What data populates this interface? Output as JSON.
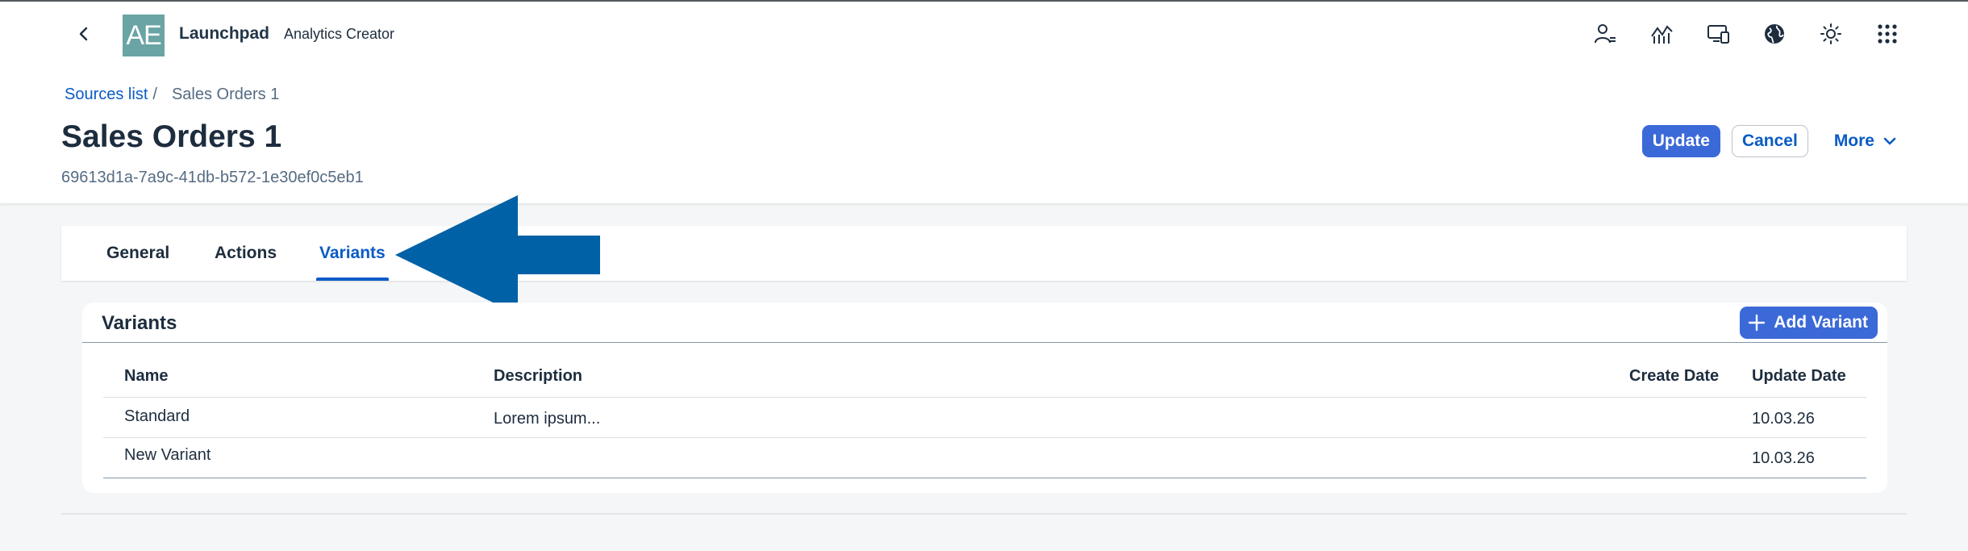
{
  "shell": {
    "logo_text": "AE",
    "brand": "Launchpad",
    "app_name": "Analytics Creator",
    "icons": [
      "user-settings-icon",
      "analytics-icon",
      "device-icon",
      "globe-icon",
      "theme-icon",
      "app-grid-icon"
    ]
  },
  "header": {
    "breadcrumb_link": "Sources list",
    "breadcrumb_sep": "/",
    "breadcrumb_current": "Sales Orders 1",
    "title": "Sales Orders 1",
    "subtitle": "69613d1a-7a9c-41db-b572-1e30ef0c5eb1",
    "update_label": "Update",
    "cancel_label": "Cancel",
    "more_label": "More"
  },
  "tabs": [
    {
      "label": "General"
    },
    {
      "label": "Actions"
    },
    {
      "label": "Variants",
      "active": true
    }
  ],
  "variants": {
    "title": "Variants",
    "add_label": "Add Variant",
    "columns": [
      "Name",
      "Description",
      "Create Date",
      "Update Date"
    ],
    "rows": [
      {
        "name": "Standard",
        "description": "Lorem ipsum...",
        "create_date": "",
        "update_date": "10.03.26"
      },
      {
        "name": "New Variant",
        "description": "",
        "create_date": "",
        "update_date": "10.03.26"
      }
    ]
  },
  "colors": {
    "accent": "#0a5bc6",
    "button": "#3b69d8",
    "arrow": "#0061a6",
    "logo": "#6aa4a4"
  }
}
